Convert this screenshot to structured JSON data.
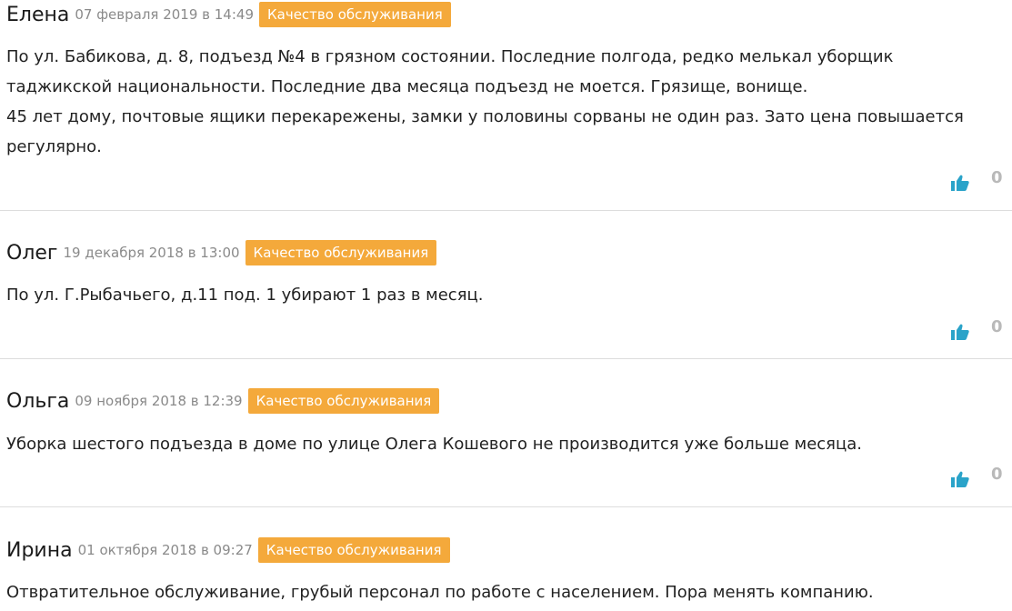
{
  "reviews": [
    {
      "author": "Елена",
      "date": "07 февраля 2019 в 14:49",
      "category": "Качество обслуживания",
      "text": "По ул. Бабикова, д. 8, подъезд №4 в грязном состоянии. Последние полгода, редко мелькал уборщик таджикской национальности. Последние два месяца подъезд не моется. Грязище, вонище.\n45 лет дому, почтовые ящики перекарежены, замки у половины сорваны не один раз. Зато цена повышается регулярно.",
      "likes": "0"
    },
    {
      "author": "Олег",
      "date": "19 декабря 2018 в 13:00",
      "category": "Качество обслуживания",
      "text": "По ул. Г.Рыбачьего, д.11 под. 1 убирают 1 раз в месяц.",
      "likes": "0"
    },
    {
      "author": "Ольга",
      "date": "09 ноября 2018 в 12:39",
      "category": "Качество обслуживания",
      "text": "Уборка шестого подъезда в доме по улице Олега Кошевого не производится уже больше месяца.",
      "likes": "0"
    },
    {
      "author": "Ирина",
      "date": "01 октября 2018 в 09:27",
      "category": "Качество обслуживания",
      "text": "Отвратительное обслуживание, грубый персонал по работе с населением. Пора менять компанию."
    }
  ],
  "colors": {
    "category_badge": "#f4a93b",
    "like_icon": "#2aa3c9",
    "count": "#b9b9b9"
  },
  "icons": {
    "like": "thumbs-up-icon"
  }
}
